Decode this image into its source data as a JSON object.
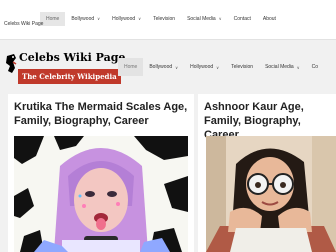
{
  "topbar": {
    "site_title": "Celebs Wiki Page",
    "nav": [
      {
        "label": "Home",
        "active": true,
        "has_dropdown": false
      },
      {
        "label": "Bollywood",
        "active": false,
        "has_dropdown": true
      },
      {
        "label": "Hollywood",
        "active": false,
        "has_dropdown": true
      },
      {
        "label": "Television",
        "active": false,
        "has_dropdown": false
      },
      {
        "label": "Social Media",
        "active": false,
        "has_dropdown": true
      },
      {
        "label": "Contact",
        "active": false,
        "has_dropdown": false
      },
      {
        "label": "About",
        "active": false,
        "has_dropdown": false
      }
    ]
  },
  "header": {
    "brand": "Celebs Wiki Page",
    "tagline": "The Celebrity Wikipedia",
    "nav": [
      {
        "label": "Home",
        "active": true,
        "has_dropdown": false
      },
      {
        "label": "Bollywood",
        "active": false,
        "has_dropdown": true
      },
      {
        "label": "Hollywood",
        "active": false,
        "has_dropdown": true
      },
      {
        "label": "Television",
        "active": false,
        "has_dropdown": false
      },
      {
        "label": "Social Media",
        "active": false,
        "has_dropdown": true
      },
      {
        "label": "Co",
        "active": false,
        "has_dropdown": false
      }
    ]
  },
  "posts": [
    {
      "title": "Krutika The Mermaid Scales Age, Family, Biography, Career"
    },
    {
      "title": "Ashnoor Kaur Age, Family, Biography, Career"
    }
  ],
  "colors": {
    "accent": "#c0392b",
    "caret": "∨"
  }
}
